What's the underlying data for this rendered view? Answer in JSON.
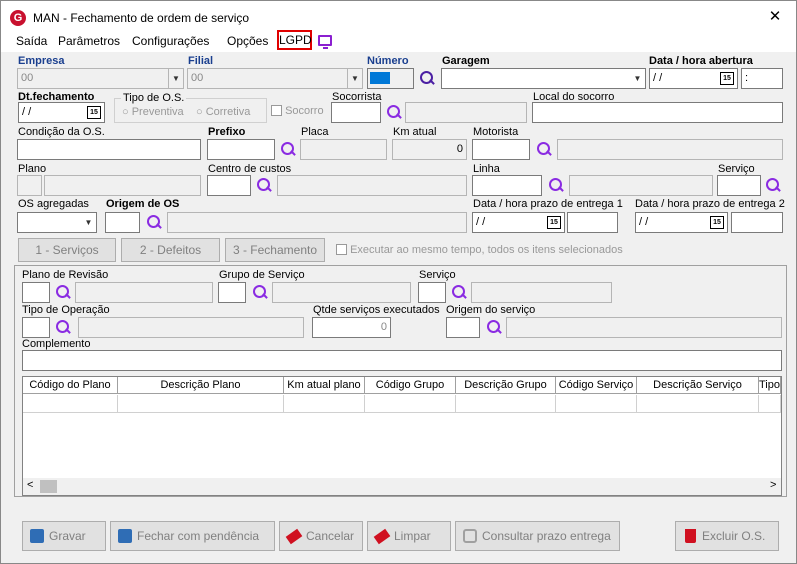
{
  "window": {
    "title": "MAN - Fechamento de ordem de serviço",
    "logo": "G"
  },
  "menu": {
    "items": [
      "Saída",
      "Parâmetros",
      "Configurações",
      "Opções"
    ],
    "lgpd": "LGPD"
  },
  "fields": {
    "empresa": {
      "label": "Empresa",
      "value": "00"
    },
    "filial": {
      "label": "Filial",
      "value": "00"
    },
    "numero": {
      "label": "Número"
    },
    "garagem": {
      "label": "Garagem"
    },
    "data_abertura": {
      "label": "Data / hora abertura",
      "date": "/ /",
      "time": ":"
    },
    "dt_fechamento": {
      "label": "Dt.fechamento",
      "date": "/ /"
    },
    "tipo_os": {
      "label": "Tipo de O.S.",
      "opt1": "Preventiva",
      "opt2": "Corretiva"
    },
    "socorro": {
      "label": "Socorro"
    },
    "socorrista": {
      "label": "Socorrista"
    },
    "local_socorro": {
      "label": "Local do socorro"
    },
    "condicao": {
      "label": "Condição da O.S."
    },
    "prefixo": {
      "label": "Prefixo"
    },
    "placa": {
      "label": "Placa"
    },
    "km_atual": {
      "label": "Km atual",
      "value": "0"
    },
    "motorista": {
      "label": "Motorista"
    },
    "plano": {
      "label": "Plano"
    },
    "centro_custos": {
      "label": "Centro de custos"
    },
    "linha": {
      "label": "Linha"
    },
    "servico": {
      "label": "Serviço"
    },
    "os_agregadas": {
      "label": "OS agregadas"
    },
    "origem_os": {
      "label": "Origem de OS"
    },
    "prazo1": {
      "label": "Data / hora prazo de entrega 1",
      "date": "/ /"
    },
    "prazo2": {
      "label": "Data / hora prazo de entrega 2",
      "date": "/ /"
    }
  },
  "step_buttons": {
    "servicos": "1 - Serviços",
    "defeitos": "2 - Defeitos",
    "fechamento": "3 - Fechamento",
    "executar": "Executar ao mesmo tempo, todos os itens selecionados"
  },
  "panel": {
    "plano_revisao": "Plano de Revisão",
    "grupo_servico": "Grupo de Serviço",
    "servico": "Serviço",
    "tipo_operacao": "Tipo de Operação",
    "qtde": {
      "label": "Qtde serviços executados",
      "value": "0"
    },
    "origem_servico": "Origem do serviço",
    "complemento": "Complemento"
  },
  "grid": {
    "columns": [
      "Código do Plano",
      "Descrição Plano",
      "Km atual plano",
      "Código Grupo",
      "Descrição Grupo",
      "Código Serviço",
      "Descrição Serviço",
      "Tipo"
    ]
  },
  "footer": {
    "gravar": "Gravar",
    "fechar_pendencia": "Fechar com pendência",
    "cancelar": "Cancelar",
    "limpar": "Limpar",
    "consultar": "Consultar prazo entrega",
    "excluir": "Excluir O.S."
  },
  "calendar_icon_text": "15",
  "colors": {
    "lgpd_border": "#e00000",
    "search_icon": "#8a2be2",
    "label_blue": "#1a3f8f",
    "numero_fill": "#0078d7"
  }
}
